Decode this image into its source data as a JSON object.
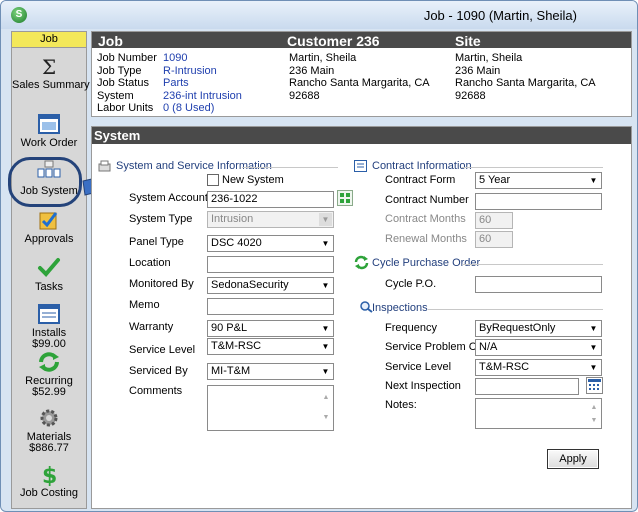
{
  "window": {
    "title": "Job - 1090 (Martin, Sheila)",
    "app_icon_letter": "S"
  },
  "sidebar": {
    "header": "Job",
    "items": [
      {
        "id": "sales-summary",
        "label": "Sales Summary",
        "icon": "sigma-icon"
      },
      {
        "id": "work-order",
        "label": "Work Order",
        "icon": "window-icon"
      },
      {
        "id": "job-system",
        "label": "Job System",
        "icon": "devices-icon"
      },
      {
        "id": "approvals",
        "label": "Approvals",
        "icon": "approval-icon"
      },
      {
        "id": "tasks",
        "label": "Tasks",
        "icon": "check-icon"
      },
      {
        "id": "installs",
        "label": "Installs",
        "value": "$99.00",
        "icon": "list-icon"
      },
      {
        "id": "recurring",
        "label": "Recurring",
        "value": "$52.99",
        "icon": "recycle-icon"
      },
      {
        "id": "materials",
        "label": "Materials",
        "value": "$886.77",
        "icon": "gear-icon"
      },
      {
        "id": "job-costing",
        "label": "Job Costing",
        "icon": "dollar-icon"
      }
    ]
  },
  "header": {
    "job_heading": "Job",
    "customer_heading": "Customer 236",
    "site_heading": "Site",
    "job": [
      {
        "k": "Job Number",
        "v": "1090"
      },
      {
        "k": "Job Type",
        "v": "R-Intrusion"
      },
      {
        "k": "Job Status",
        "v": "Parts"
      },
      {
        "k": "System",
        "v": "236-int Intrusion"
      },
      {
        "k": "Labor Units",
        "v": "0 (8 Used)"
      }
    ],
    "customer": [
      "Martin, Sheila",
      "236 Main",
      "Rancho Santa Margarita, CA",
      "92688"
    ],
    "site": [
      "Martin, Sheila",
      "236 Main",
      "Rancho Santa Margarita, CA",
      "92688"
    ]
  },
  "panel": {
    "title": "System",
    "system_section": "System and Service Information",
    "new_system": "New System",
    "system_account_label": "System Account",
    "system_account": "236-1022",
    "system_type_label": "System Type",
    "system_type": "Intrusion",
    "panel_type_label": "Panel Type",
    "panel_type": "DSC 4020",
    "location_label": "Location",
    "location": "",
    "monitored_by_label": "Monitored By",
    "monitored_by": "SedonaSecurity",
    "memo_label": "Memo",
    "memo": "",
    "warranty_label": "Warranty",
    "warranty": "90 P&L",
    "service_level_label": "Service Level",
    "service_level": "T&M-RSC",
    "serviced_by_label": "Serviced By",
    "serviced_by": "MI-T&M",
    "comments_label": "Comments",
    "comments": "",
    "contract_section": "Contract Information",
    "contract_form_label": "Contract Form",
    "contract_form": "5 Year",
    "contract_number_label": "Contract Number",
    "contract_number": "",
    "contract_months_label": "Contract Months",
    "contract_months": "60",
    "renewal_months_label": "Renewal Months",
    "renewal_months": "60",
    "cycle_section": "Cycle Purchase Order",
    "cycle_po_label": "Cycle P.O.",
    "cycle_po": "",
    "inspections_section": "Inspections",
    "frequency_label": "Frequency",
    "frequency": "ByRequestOnly",
    "problem_code_label": "Service Problem Code",
    "problem_code": "N/A",
    "insp_service_level_label": "Service Level",
    "insp_service_level": "T&M-RSC",
    "next_inspection_label": "Next Inspection",
    "next_inspection": "",
    "notes_label": "Notes:",
    "notes": "",
    "apply_label": "Apply"
  },
  "colors": {
    "accent": "#24437a",
    "link_value": "#1f3fae",
    "header_bar": "#4a4a4a",
    "sidebar_header": "#f3e85a"
  }
}
